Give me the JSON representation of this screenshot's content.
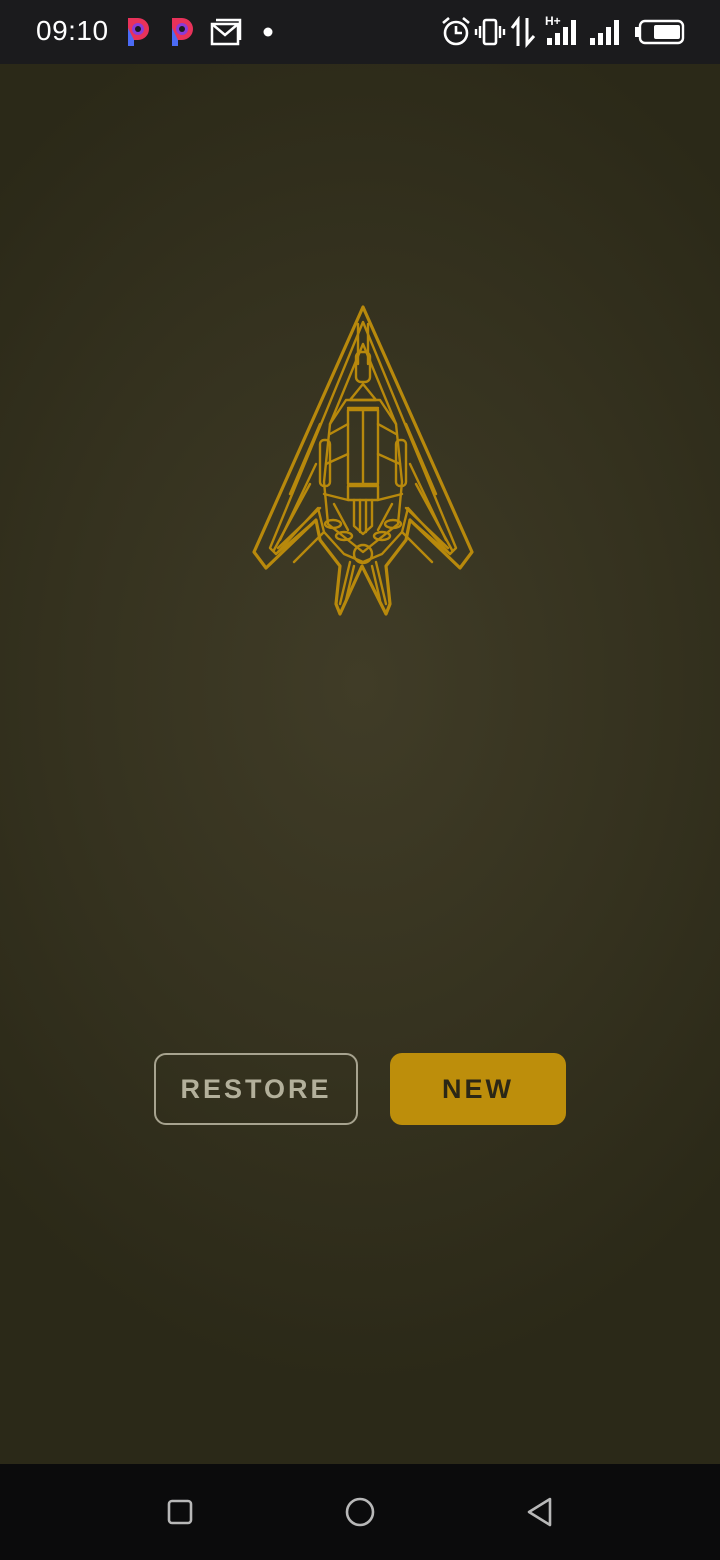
{
  "status_bar": {
    "time": "09:10",
    "left_icons": [
      "pocket-p-icon",
      "pocket-p-icon",
      "gmail-icon",
      "notification-dot-icon"
    ],
    "right_icons": [
      "alarm-icon",
      "vibrate-icon",
      "data-transfer-icon",
      "h-plus-signal-icon",
      "signal-icon",
      "battery-icon"
    ],
    "network_label": "H+"
  },
  "main": {
    "logo_icon": "stealth-aircraft-icon",
    "logo_color": "#b8890c",
    "restore_label": "RESTORE",
    "new_label": "NEW",
    "accent_color": "#bd8e0b"
  },
  "nav_bar": {
    "icons": [
      "recent-apps-icon",
      "home-icon",
      "back-icon"
    ]
  }
}
